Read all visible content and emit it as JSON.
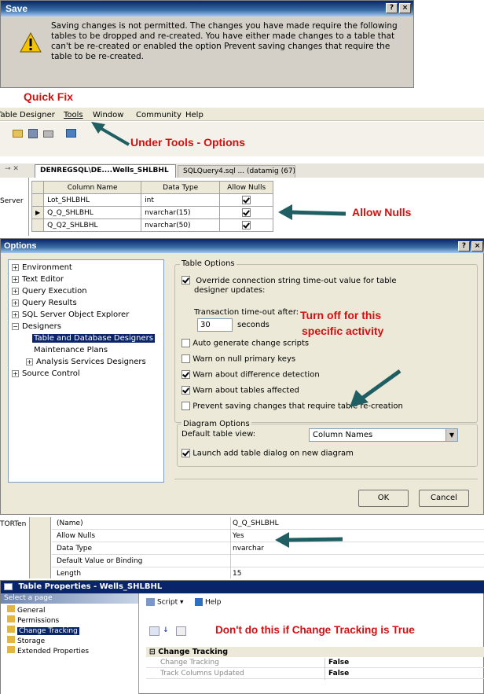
{
  "save_dialog": {
    "title": "Save",
    "message": "Saving changes is not permitted. The changes you have made require the following tables to be dropped and re-created. You have either made changes to a table that can't be re-created or enabled the option Prevent saving changes that require the table to be re-created."
  },
  "annotations": {
    "quick_fix": "Quick Fix",
    "under_tools": "Under Tools - Options",
    "allow_nulls": "Allow Nulls",
    "turn_off_line1": "Turn off for this",
    "turn_off_line2": "specific activity",
    "dont_do": "Don't do this if Change Tracking is True"
  },
  "menu_bar": {
    "items": [
      "Table Designer",
      "Tools",
      "Window",
      "Community",
      "Help"
    ]
  },
  "designer": {
    "tab_active": "DENREGSQL\\DE....Wells_SHLBHL",
    "tab_inactive": "SQLQuery4.sql ... (datamig (67))",
    "side_text": "Server",
    "headers": [
      "Column Name",
      "Data Type",
      "Allow Nulls"
    ],
    "rows": [
      {
        "name": "Lot_SHLBHL",
        "type": "int"
      },
      {
        "name": "Q_Q_SHLBHL",
        "type": "nvarchar(15)"
      },
      {
        "name": "Q_Q2_SHLBHL",
        "type": "nvarchar(50)"
      }
    ]
  },
  "options": {
    "title": "Options",
    "tree": [
      {
        "sign": "+",
        "label": "Environment"
      },
      {
        "sign": "+",
        "label": "Text Editor"
      },
      {
        "sign": "+",
        "label": "Query Execution"
      },
      {
        "sign": "+",
        "label": "Query Results"
      },
      {
        "sign": "+",
        "label": "SQL Server Object Explorer"
      },
      {
        "sign": "-",
        "label": "Designers"
      },
      {
        "sign": "",
        "label": "Table and Database Designers"
      },
      {
        "sign": "",
        "label": "Maintenance Plans"
      },
      {
        "sign": "+",
        "label": "Analysis Services Designers"
      },
      {
        "sign": "+",
        "label": "Source Control"
      }
    ],
    "table_options_legend": "Table Options",
    "override_line1": "Override connection string time-out value for table",
    "override_line2": "designer updates:",
    "timeout_label": "Transaction time-out after:",
    "timeout_value": "30",
    "seconds": "seconds",
    "checks": [
      "Auto generate change scripts",
      "Warn on null primary keys",
      "Warn about difference detection",
      "Warn about tables affected",
      "Prevent saving changes that require table re-creation"
    ],
    "diagram_legend": "Diagram Options",
    "default_view_label": "Default table view:",
    "default_view_value": "Column Names",
    "launch_add_table": "Launch add table dialog on new diagram",
    "ok": "OK",
    "cancel": "Cancel"
  },
  "properties": {
    "left_text": "TORTen",
    "rows": [
      {
        "k": "(Name)",
        "v": "Q_Q_SHLBHL"
      },
      {
        "k": "Allow Nulls",
        "v": "Yes"
      },
      {
        "k": "Data Type",
        "v": "nvarchar"
      },
      {
        "k": "Default Value or Binding",
        "v": ""
      },
      {
        "k": "Length",
        "v": "15"
      }
    ]
  },
  "table_props": {
    "title": "Table Properties - Wells_SHLBHL",
    "select_page": "Select a page",
    "pages": [
      "General",
      "Permissions",
      "Change Tracking",
      "Storage",
      "Extended Properties"
    ],
    "script": "Script",
    "help": "Help",
    "section": "Change Tracking",
    "rows": [
      {
        "k": "Change Tracking",
        "v": "False"
      },
      {
        "k": "Track Columns Updated",
        "v": "False"
      }
    ]
  }
}
